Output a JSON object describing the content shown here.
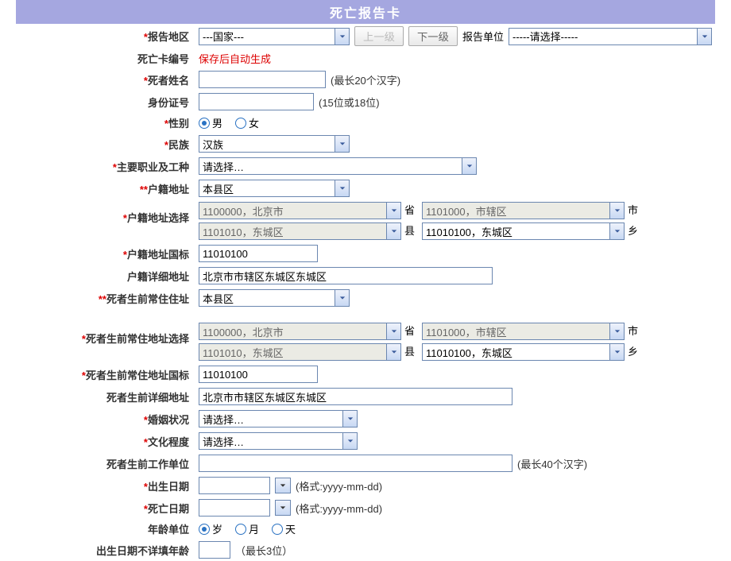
{
  "title": "死亡报告卡",
  "rows": {
    "report_region": {
      "label": "报告地区",
      "select": "---国家---",
      "prev": "上一级",
      "next": "下一级",
      "unit_label": "报告单位",
      "unit_select": "-----请选择-----"
    },
    "card_no": {
      "label": "死亡卡编号",
      "value": "保存后自动生成"
    },
    "name": {
      "label": "死者姓名",
      "hint": "(最长20个汉字)"
    },
    "id_no": {
      "label": "身份证号",
      "hint": "(15位或18位)"
    },
    "gender": {
      "label": "性别",
      "male": "男",
      "female": "女"
    },
    "nation": {
      "label": "民族",
      "value": "汉族"
    },
    "occupation": {
      "label": "主要职业及工种",
      "value": "请选择…"
    },
    "hukou_addr": {
      "label": "户籍地址",
      "value": "本县区"
    },
    "hukou_select": {
      "label": "户籍地址选择",
      "prov": "1100000，北京市",
      "prov_suf": "省",
      "city": "1101000，市辖区",
      "city_suf": "市",
      "county": "1101010，东城区",
      "county_suf": "县",
      "town": "11010100，东城区",
      "town_suf": "乡"
    },
    "hukou_gb": {
      "label": "户籍地址国标",
      "value": "11010100"
    },
    "hukou_detail": {
      "label": "户籍详细地址",
      "value": "北京市市辖区东城区东城区"
    },
    "res_addr": {
      "label": "死者生前常住住址",
      "value": "本县区"
    },
    "res_select": {
      "label": "死者生前常住地址选择",
      "prov": "1100000，北京市",
      "prov_suf": "省",
      "city": "1101000，市辖区",
      "city_suf": "市",
      "county": "1101010，东城区",
      "county_suf": "县",
      "town": "11010100，东城区",
      "town_suf": "乡"
    },
    "res_gb": {
      "label": "死者生前常住地址国标",
      "value": "11010100"
    },
    "res_detail": {
      "label": "死者生前详细地址",
      "value": "北京市市辖区东城区东城区"
    },
    "marital": {
      "label": "婚姻状况",
      "value": "请选择…"
    },
    "edu": {
      "label": "文化程度",
      "value": "请选择…"
    },
    "work_unit": {
      "label": "死者生前工作单位",
      "hint": "(最长40个汉字)"
    },
    "birth_date": {
      "label": "出生日期",
      "hint": "(格式:yyyy-mm-dd)"
    },
    "death_date": {
      "label": "死亡日期",
      "hint": "(格式:yyyy-mm-dd)"
    },
    "age_unit": {
      "label": "年龄单位",
      "year": "岁",
      "month": "月",
      "day": "天"
    },
    "age_unknown": {
      "label": "出生日期不详填年龄",
      "hint": "（最长3位）"
    }
  }
}
